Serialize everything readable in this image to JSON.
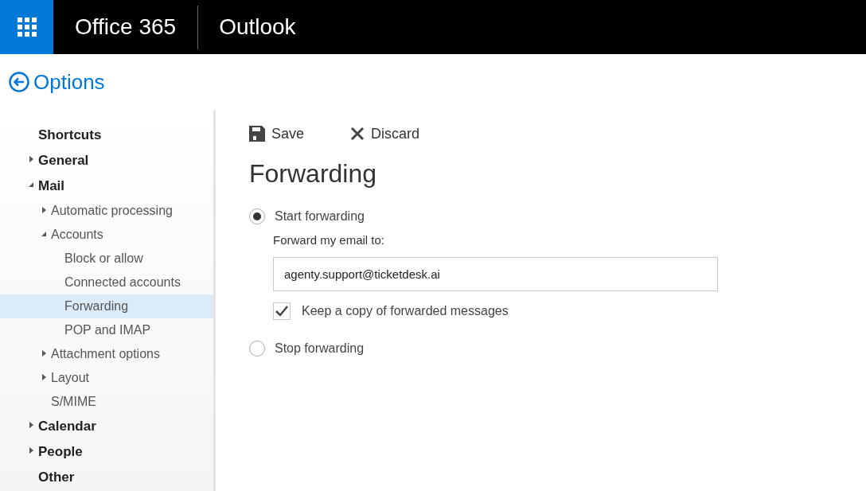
{
  "header": {
    "brand": "Office 365",
    "app": "Outlook"
  },
  "page_title": "Options",
  "sidebar": {
    "items": [
      {
        "label": "Shortcuts",
        "selected": false
      },
      {
        "label": "General",
        "selected": false,
        "expanded": false
      },
      {
        "label": "Mail",
        "selected": false,
        "expanded": true,
        "children": [
          {
            "label": "Automatic processing",
            "selected": false,
            "expanded": false
          },
          {
            "label": "Accounts",
            "selected": false,
            "expanded": true,
            "children": [
              {
                "label": "Block or allow",
                "selected": false
              },
              {
                "label": "Connected accounts",
                "selected": false
              },
              {
                "label": "Forwarding",
                "selected": true
              },
              {
                "label": "POP and IMAP",
                "selected": false
              }
            ]
          },
          {
            "label": "Attachment options",
            "selected": false,
            "expanded": false
          },
          {
            "label": "Layout",
            "selected": false,
            "expanded": false
          },
          {
            "label": "S/MIME",
            "selected": false
          }
        ]
      },
      {
        "label": "Calendar",
        "selected": false,
        "expanded": false
      },
      {
        "label": "People",
        "selected": false,
        "expanded": false
      },
      {
        "label": "Other",
        "selected": false
      }
    ]
  },
  "toolbar": [
    {
      "kind": "save",
      "label": "Save"
    },
    {
      "kind": "discard",
      "label": "Discard"
    }
  ],
  "heading": "Forwarding",
  "options": [
    {
      "label": "Start forwarding",
      "selected": true,
      "field_label": "Forward my email to:",
      "value": "agenty.support@ticketdesk.ai",
      "checkbox": {
        "label": "Keep a copy of forwarded messages",
        "checked": true
      }
    },
    {
      "label": "Stop forwarding",
      "selected": false
    }
  ]
}
